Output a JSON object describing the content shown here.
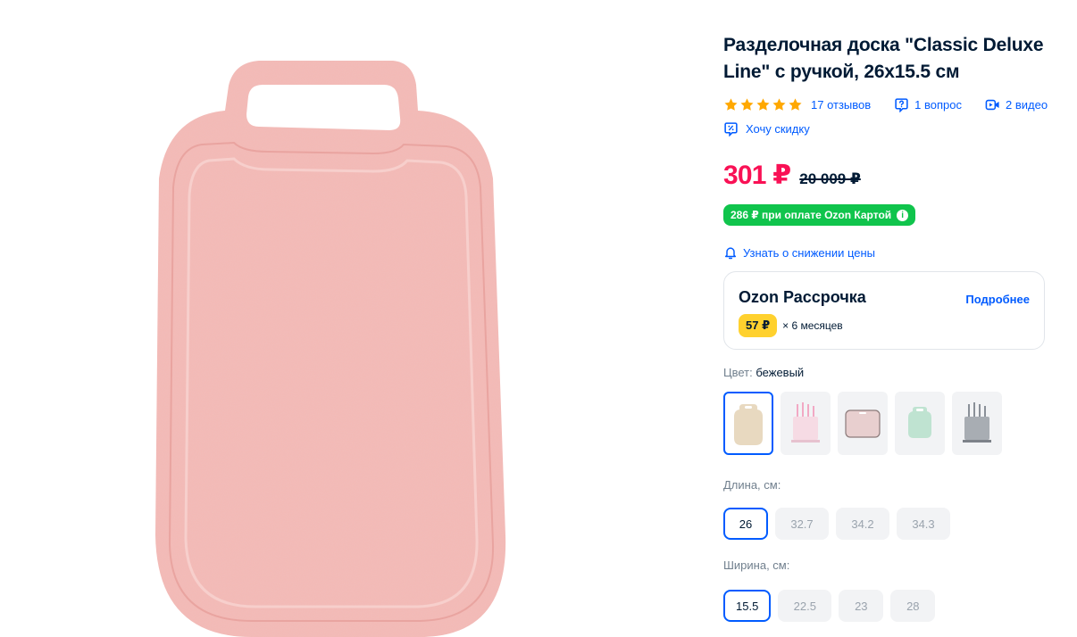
{
  "product": {
    "title": "Разделочная доска \"Classic Deluxe Line\" с ручкой, 26x15.5 см",
    "rating": 5,
    "reviews": "17 отзывов",
    "questions": "1 вопрос",
    "videos": "2 видео",
    "discount_link": "Хочу скидку"
  },
  "price": {
    "current": "301 ₽",
    "old": "20 009 ₽",
    "ozon_card": "286 ₽ при оплате Ozon Картой",
    "alert": "Узнать о снижении цены"
  },
  "installment": {
    "title": "Ozon Рассрочка",
    "more": "Подробнее",
    "amount": "57 ₽",
    "months": "× 6 месяцев"
  },
  "color": {
    "label": "Цвет:",
    "value": "бежевый",
    "options": [
      "бежевый",
      "розовый",
      "розовый",
      "зеленый",
      "серый"
    ]
  },
  "length": {
    "label": "Длина, см:",
    "options": [
      "26",
      "32.7",
      "34.2",
      "34.3"
    ],
    "selected": "26"
  },
  "width": {
    "label": "Ширина, см:",
    "options": [
      "15.5",
      "22.5",
      "23",
      "28"
    ],
    "selected": "15.5"
  },
  "colors": {
    "accent": "#005bff",
    "price": "#f91155",
    "card_green": "#10c44c",
    "rating": "#ffa800",
    "installment_badge": "#ffd12e",
    "board": "#f3b7b4"
  },
  "icons": {
    "rating": "star-icon",
    "questions": "question-bubble-icon",
    "videos": "video-icon",
    "discount": "discount-icon",
    "alert": "bell-icon",
    "info": "info-icon"
  }
}
